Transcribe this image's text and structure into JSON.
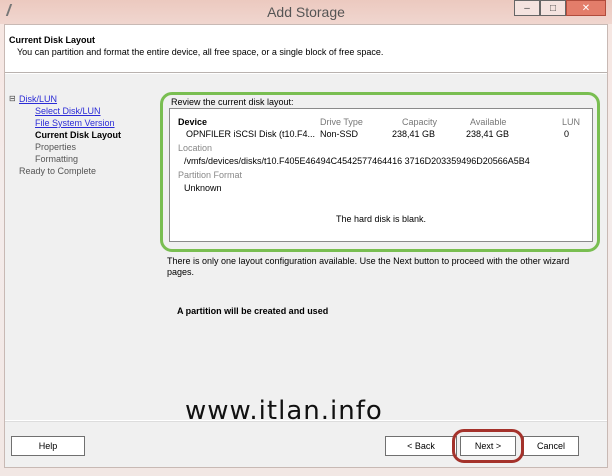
{
  "window": {
    "title": "Add Storage",
    "minimize_label": "–",
    "maximize_label": "□",
    "close_label": "✕"
  },
  "header": {
    "title": "Current Disk Layout",
    "subtitle": "You can partition and format the entire device, all free space, or a single block of free space."
  },
  "nav": {
    "toggle": "⊟",
    "items": [
      {
        "label": "Disk/LUN"
      },
      {
        "label": "Select Disk/LUN"
      },
      {
        "label": "File System Version"
      },
      {
        "label": "Current Disk Layout"
      },
      {
        "label": "Properties"
      },
      {
        "label": "Formatting"
      },
      {
        "label": "Ready to Complete"
      }
    ]
  },
  "content": {
    "review_label": "Review the current disk layout:",
    "columns": {
      "device": "Device",
      "drive_type": "Drive Type",
      "capacity": "Capacity",
      "available": "Available",
      "lun": "LUN"
    },
    "row": {
      "device": "OPNFILER iSCSI Disk (t10.F4...",
      "drive_type": "Non-SSD",
      "capacity": "238,41 GB",
      "available": "238,41 GB",
      "lun": "0"
    },
    "location_label": "Location",
    "location_value": "/vmfs/devices/disks/t10.F405E46494C4542577464416 3716D203359496D20566A5B4",
    "partition_format_label": "Partition Format",
    "partition_format_value": "Unknown",
    "blank_message": "The hard disk is blank.",
    "info_text": "There is only one layout configuration available. Use the Next button to proceed with the other wizard pages.",
    "partition_message": "A partition will be created and used",
    "watermark": "www.itlan.info"
  },
  "footer": {
    "help": "Help",
    "back": "< Back",
    "next": "Next >",
    "cancel": "Cancel"
  },
  "colors": {
    "highlight_green": "#79be51",
    "highlight_red": "#a4322b",
    "link": "#2b2bd6"
  }
}
